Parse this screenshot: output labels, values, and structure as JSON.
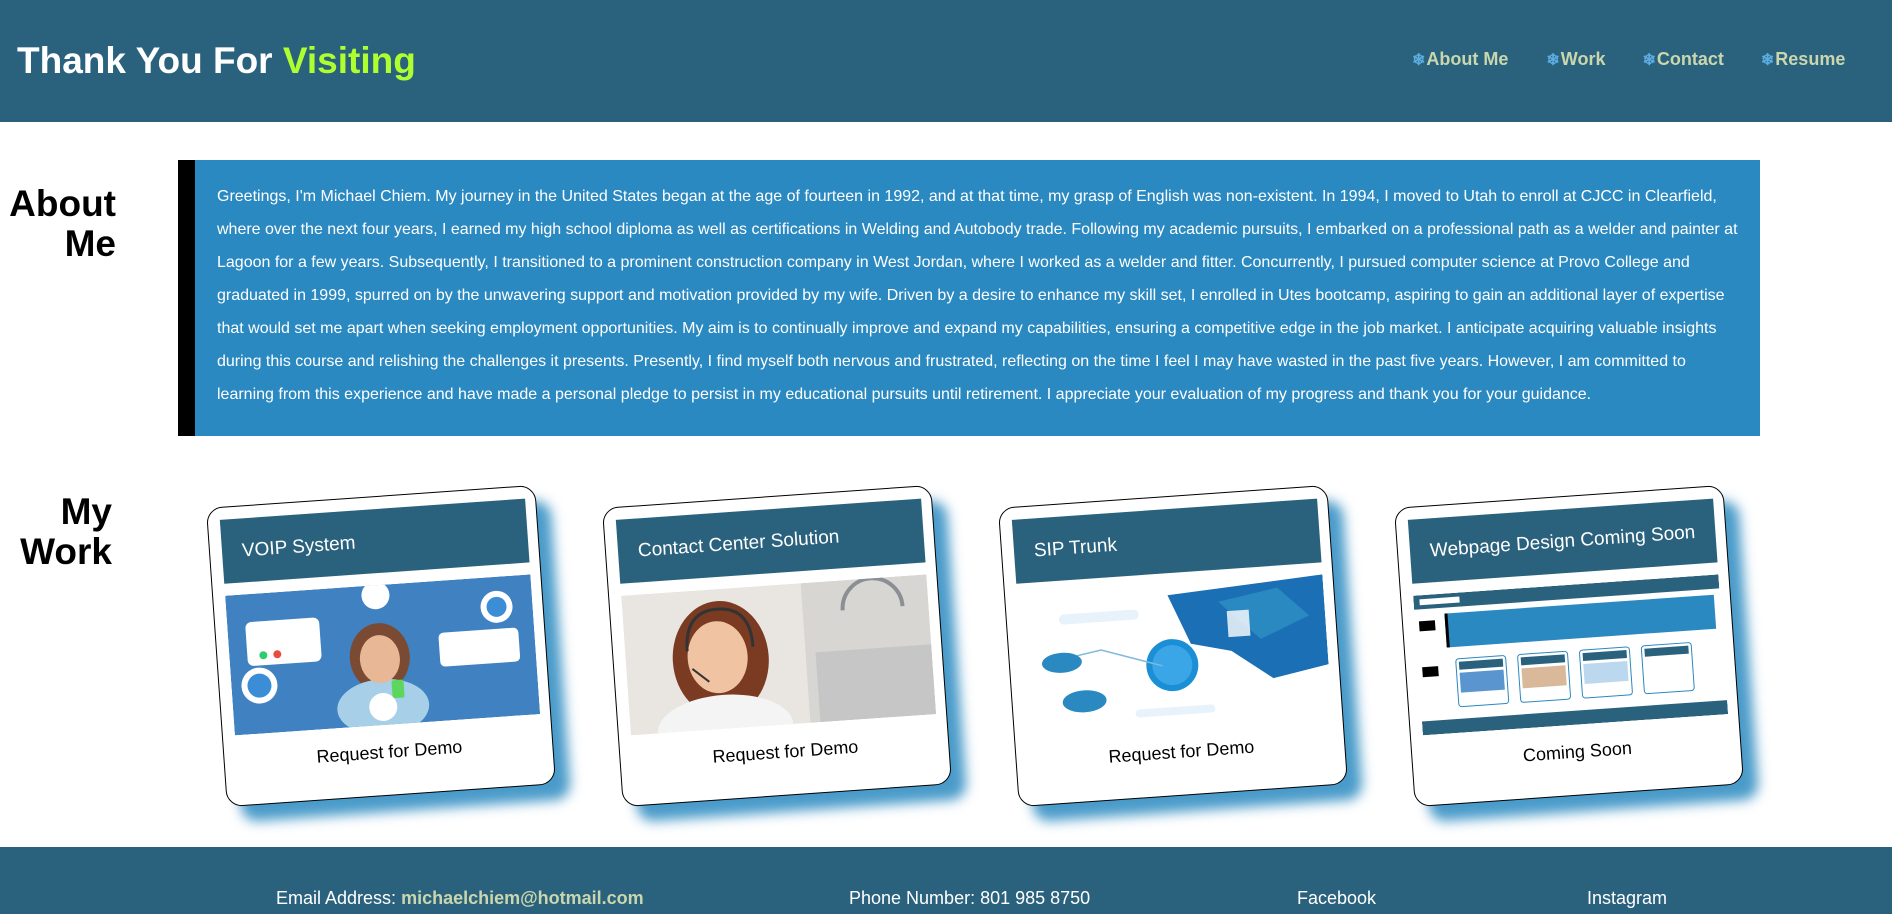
{
  "header": {
    "title_prefix": "Thank You For ",
    "title_accent": "Visiting",
    "nav": [
      {
        "icon": "snowflake-icon",
        "label": "About Me"
      },
      {
        "icon": "snowflake-icon",
        "label": "Work"
      },
      {
        "icon": "snowflake-icon",
        "label": "Contact"
      },
      {
        "icon": "snowflake-icon",
        "label": "Resume"
      }
    ]
  },
  "about": {
    "heading_line1": "About",
    "heading_line2": "Me",
    "text": "Greetings, I'm Michael Chiem. My journey in the United States began at the age of fourteen in 1992, and at that time, my grasp of English was non-existent. In 1994, I moved to Utah to enroll at CJCC in Clearfield, where over the next four years, I earned my high school diploma as well as certifications in Welding and Autobody trade. Following my academic pursuits, I embarked on a professional path as a welder and painter at Lagoon for a few years. Subsequently, I transitioned to a prominent construction company in West Jordan, where I worked as a welder and fitter. Concurrently, I pursued computer science at Provo College and graduated in 1999, spurred on by the unwavering support and motivation provided by my wife. Driven by a desire to enhance my skill set, I enrolled in Utes bootcamp, aspiring to gain an additional layer of expertise that would set me apart when seeking employment opportunities. My aim is to continually improve and expand my capabilities, ensuring a competitive edge in the job market. I anticipate acquiring valuable insights during this course and relishing the challenges it presents. Presently, I find myself both nervous and frustrated, reflecting on the time I feel I may have wasted in the past five years. However, I am committed to learning from this experience and have made a personal pledge to persist in my educational pursuits until retirement. I appreciate your evaluation of my progress and thank you for your guidance."
  },
  "work": {
    "heading_line1": "My",
    "heading_line2": "Work",
    "cards": [
      {
        "title": "VOIP System",
        "footer": "Request for Demo"
      },
      {
        "title": "Contact Center Solution",
        "footer": "Request for Demo"
      },
      {
        "title": "SIP Trunk",
        "footer": "Request for Demo"
      },
      {
        "title": "Webpage Design Coming Soon",
        "footer": "Coming Soon"
      }
    ]
  },
  "footer": {
    "email_label": "Email Address: ",
    "email": "michaelchiem@hotmail.com",
    "phone": "Phone Number: 801 985 8750",
    "facebook": "Facebook",
    "instagram": "Instagram"
  },
  "colors": {
    "header_bg": "#2a627e",
    "accent": "#adff2f",
    "about_bg": "#2a89c1",
    "nav_text": "#c9d6ae"
  }
}
